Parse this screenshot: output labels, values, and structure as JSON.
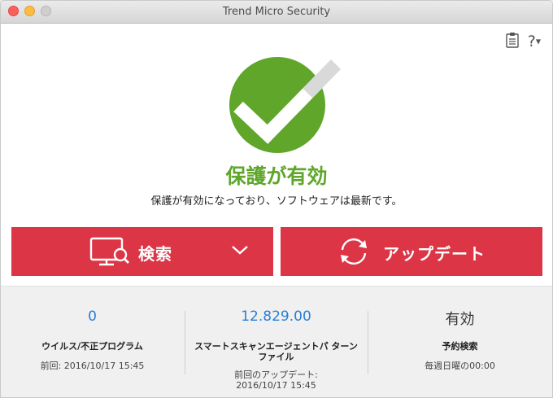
{
  "window": {
    "title": "Trend Micro Security"
  },
  "toolbar": {
    "help_label": "?"
  },
  "status": {
    "title": "保護が有効",
    "description": "保護が有効になっており、ソフトウェアは最新です。",
    "color": "#5fa62a"
  },
  "actions": {
    "scan_label": "検索",
    "update_label": "アップデート",
    "button_color": "#dc3546"
  },
  "stats": [
    {
      "value": "0",
      "label": "ウイルス/不正プログラム",
      "sub": "前回: 2016/10/17 15:45"
    },
    {
      "value": "12.829.00",
      "label": "スマートスキャンエージェントパ ターンファイル",
      "sub_line1": "前回のアップデート:",
      "sub_line2": "2016/10/17 15:45"
    },
    {
      "value": "有効",
      "label": "予約検索",
      "sub": "毎週日曜の00:00"
    }
  ],
  "icons": [
    "clipboard-icon",
    "help-icon",
    "checkmark-icon",
    "monitor-search-icon",
    "chevron-down-icon",
    "refresh-icon"
  ]
}
